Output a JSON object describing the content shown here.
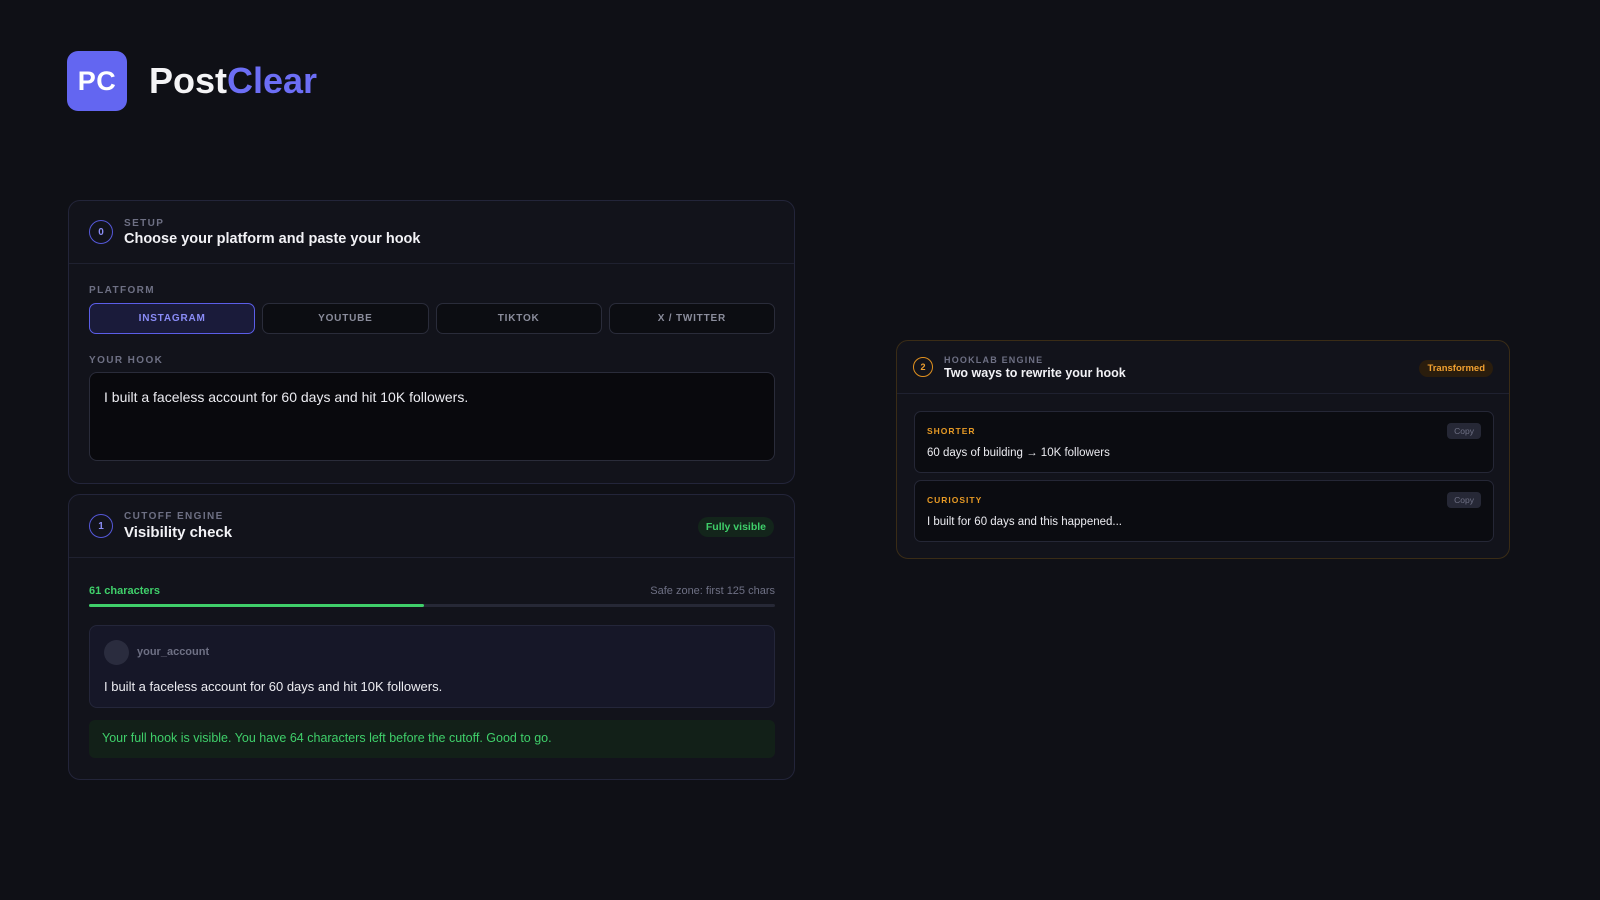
{
  "brand": {
    "logo_text": "PC",
    "name_part1": "Post",
    "name_part2": "Clear",
    "accent_color": "#6366f1"
  },
  "setup": {
    "step": "0",
    "eyebrow": "SETUP",
    "title": "Choose your platform and paste your hook",
    "platform_label": "PLATFORM",
    "platforms": [
      {
        "label": "INSTAGRAM",
        "active": true
      },
      {
        "label": "YOUTUBE",
        "active": false
      },
      {
        "label": "TIKTOK",
        "active": false
      },
      {
        "label": "X / TWITTER",
        "active": false
      }
    ],
    "hook_label": "YOUR HOOK",
    "hook_value": "I built a faceless account for 60 days and hit 10K followers."
  },
  "cutoff": {
    "step": "1",
    "eyebrow": "CUTOFF ENGINE",
    "title": "Visibility check",
    "badge": "Fully visible",
    "count_text": "61 characters",
    "safe_zone": "Safe zone: first 125 chars",
    "progress_fraction": 0.488,
    "preview": {
      "username": "your_account",
      "text": "I built a faceless account for 60 days and hit 10K followers."
    },
    "notice": "Your full hook is visible. You have 64 characters left before the cutoff. Good to go."
  },
  "hooklab": {
    "step": "2",
    "eyebrow": "HOOKLAB ENGINE",
    "title": "Two ways to rewrite your hook",
    "badge": "Transformed",
    "rewrites": [
      {
        "label": "SHORTER",
        "copy": "Copy",
        "text": "60 days of building → 10K followers"
      },
      {
        "label": "CURIOSITY",
        "copy": "Copy",
        "text": "I built for 60 days and this happened..."
      }
    ]
  },
  "colors": {
    "success": "#3fcf6a",
    "warning": "#f0a030",
    "background": "#0f1016"
  }
}
